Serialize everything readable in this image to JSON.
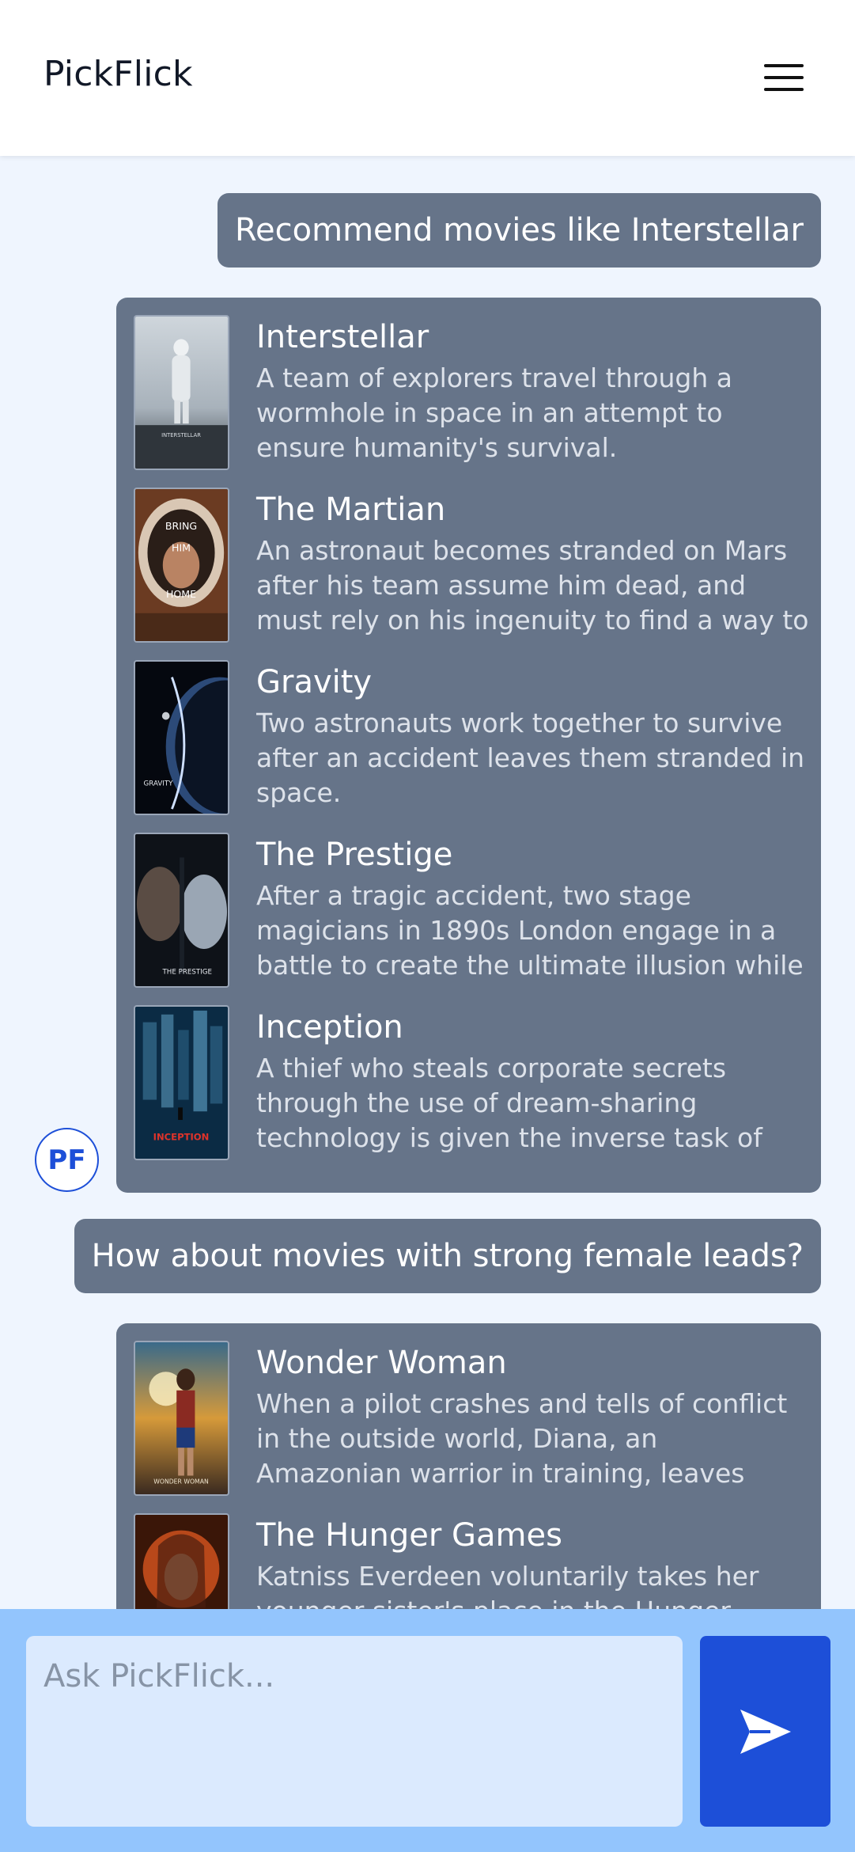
{
  "header": {
    "brand": "PickFlick"
  },
  "assistant": {
    "avatar_initials": "PF"
  },
  "conversation": [
    {
      "query": "Recommend movies like Interstellar",
      "movies": [
        {
          "title": "Interstellar",
          "description": "A team of explorers travel through a wormhole in space in an attempt to ensure humanity's survival.",
          "poster_text": "INTERSTELLAR"
        },
        {
          "title": "The Martian",
          "description": "An astronaut becomes stranded on Mars after his team assume him dead, and must rely on his ingenuity to find a way to signal to Earth that he is alive.",
          "poster_text": "BRING HIM HOME"
        },
        {
          "title": "Gravity",
          "description": "Two astronauts work together to survive after an accident leaves them stranded in space.",
          "poster_text": "GRAVITY"
        },
        {
          "title": "The Prestige",
          "description": "After a tragic accident, two stage magicians in 1890s London engage in a battle to create the ultimate illusion while sacrificing everything they have to outwit each other.",
          "poster_text": "THE PRESTIGE"
        },
        {
          "title": "Inception",
          "description": "A thief who steals corporate secrets through the use of dream-sharing technology is given the inverse task of planting an idea into the mind of a C.E.O.",
          "poster_text": "INCEPTION"
        }
      ]
    },
    {
      "query": "How about movies with strong female leads?",
      "movies": [
        {
          "title": "Wonder Woman",
          "description": "When a pilot crashes and tells of conflict in the outside world, Diana, an Amazonian warrior in training, leaves home to fight a war, discovering her full powers and true destiny.",
          "poster_text": "WONDER WOMAN"
        },
        {
          "title": "The Hunger Games",
          "description": "Katniss Everdeen voluntarily takes her younger sister's place in the Hunger Games: a televised competition.",
          "poster_text": ""
        }
      ]
    }
  ],
  "input": {
    "placeholder": "Ask PickFlick..."
  }
}
